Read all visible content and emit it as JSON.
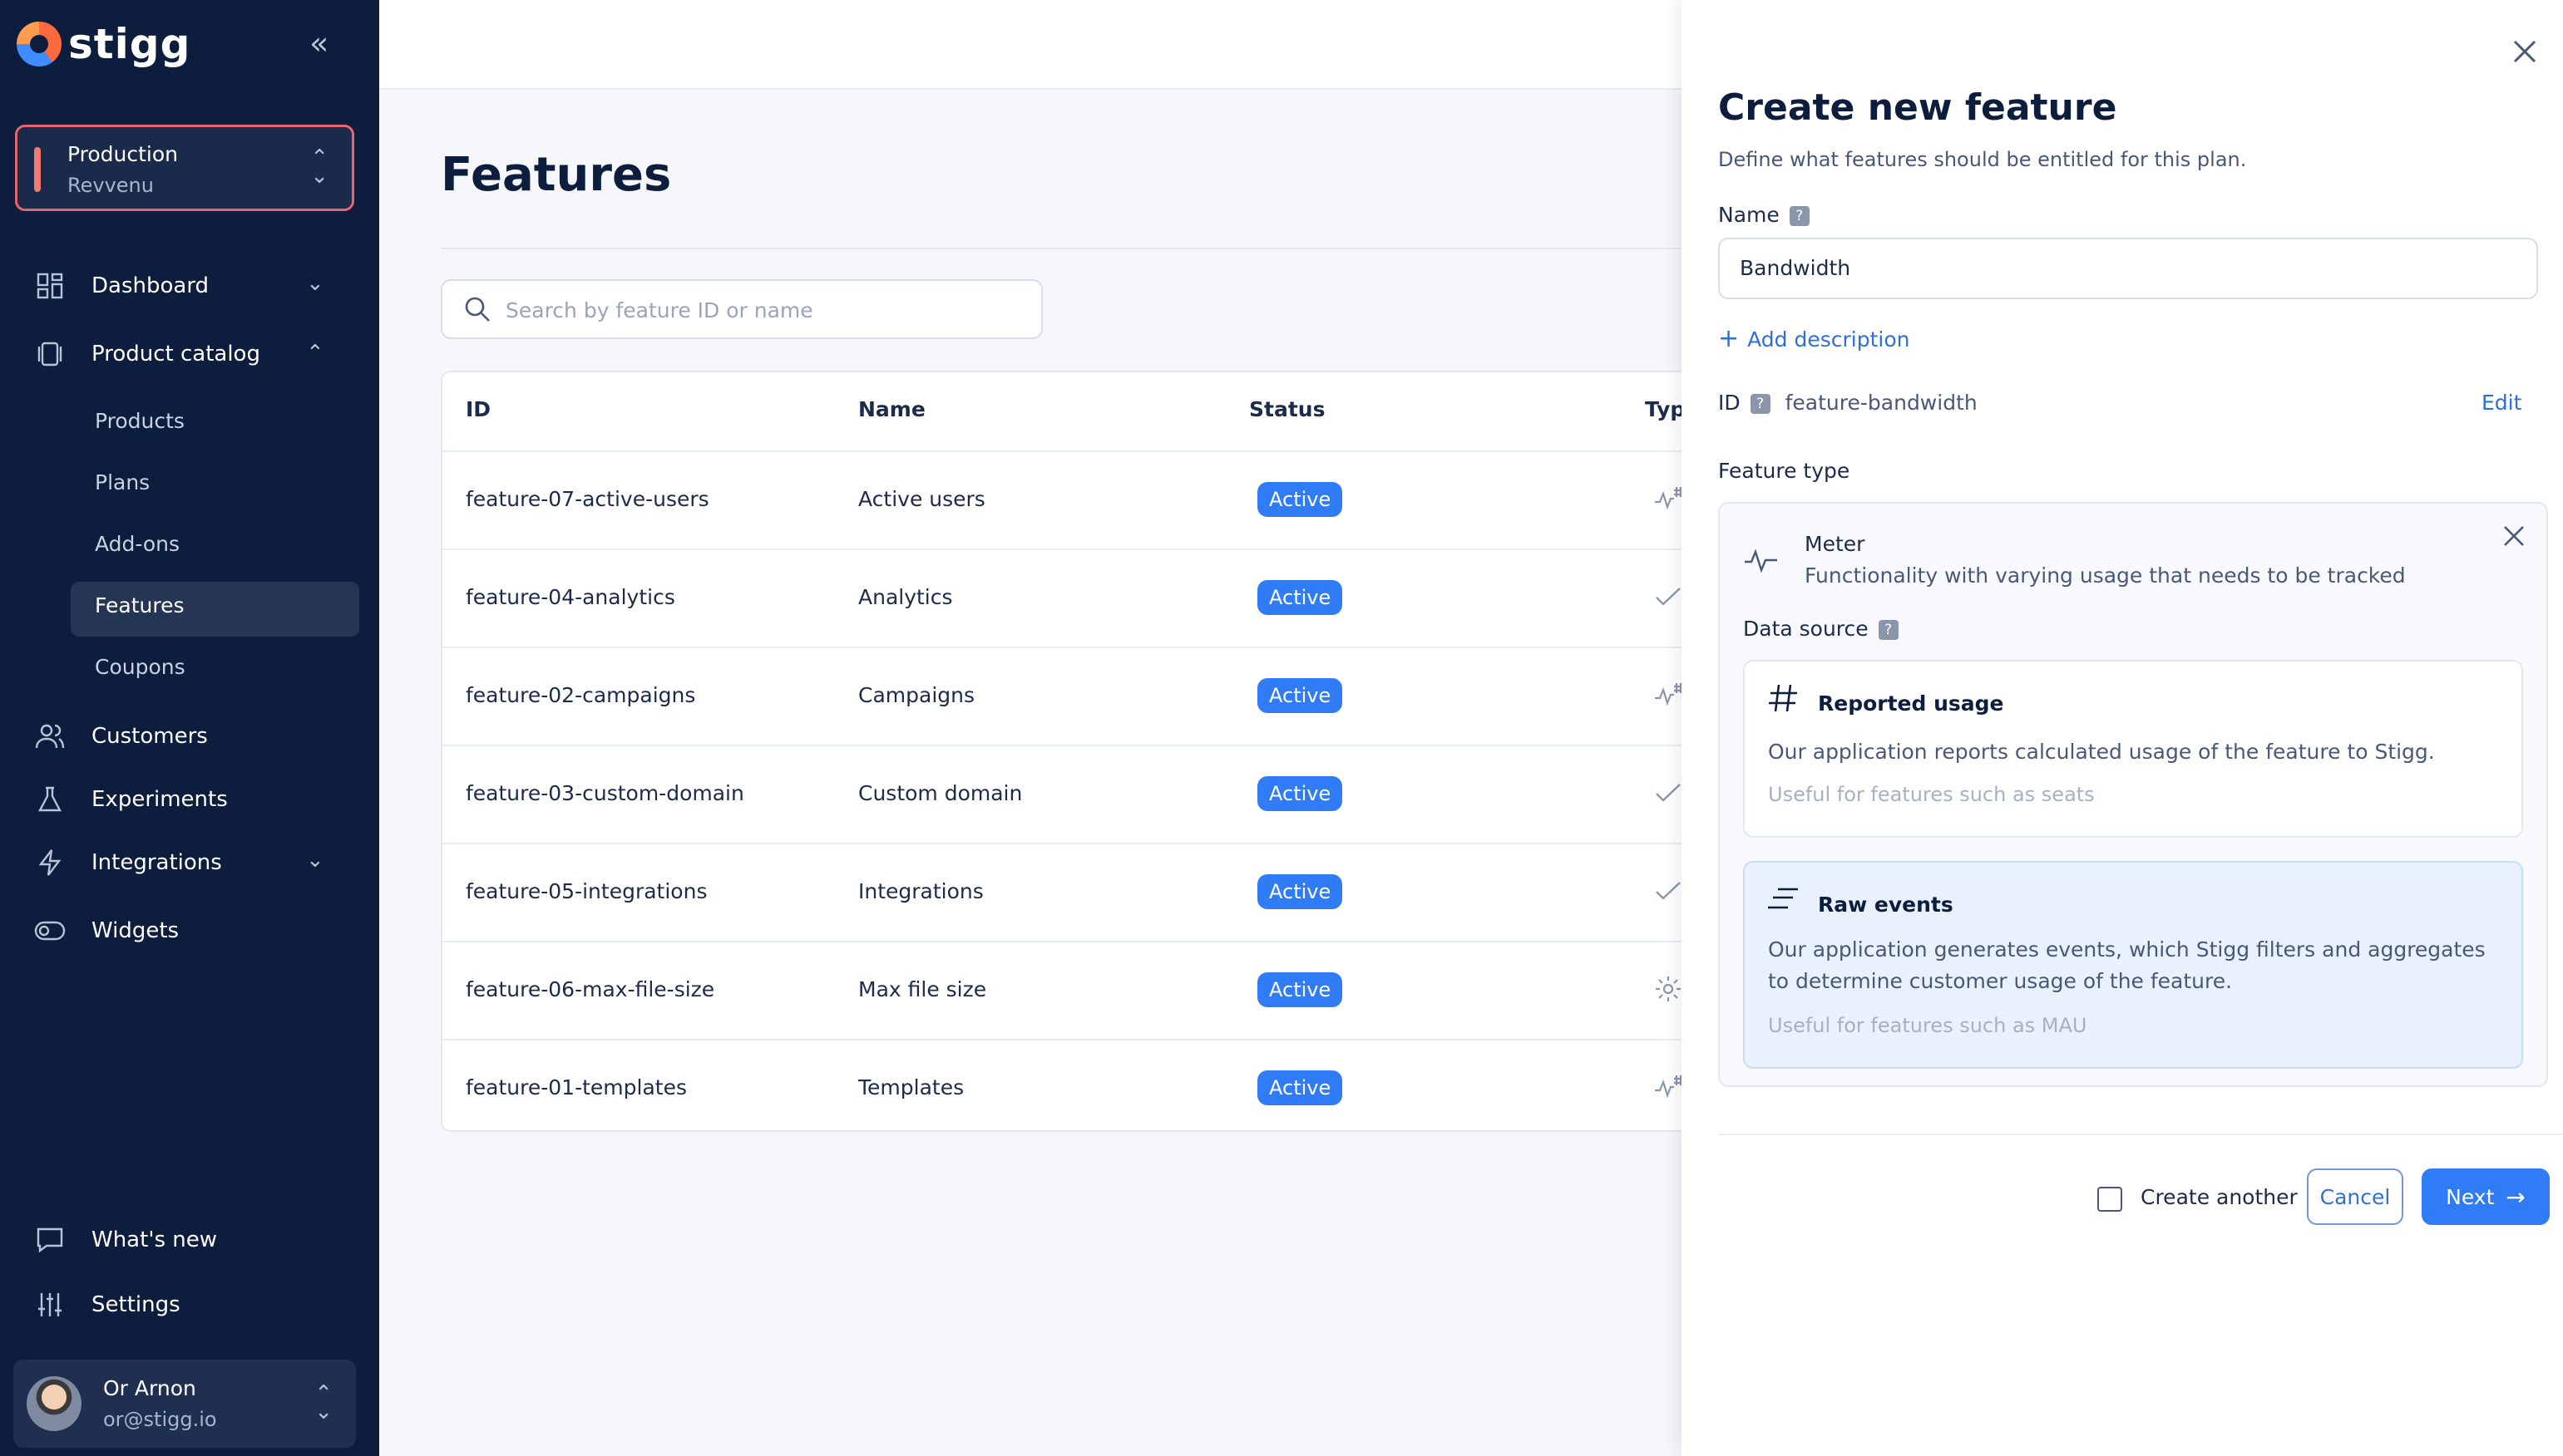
{
  "app": {
    "logo_text": "stigg"
  },
  "sidebar": {
    "environment": {
      "name": "Production",
      "account": "Revvenu"
    },
    "nav": {
      "dashboard": "Dashboard",
      "product_catalog": "Product catalog",
      "customers": "Customers",
      "experiments": "Experiments",
      "integrations": "Integrations",
      "widgets": "Widgets",
      "whats_new": "What's new",
      "settings": "Settings"
    },
    "catalog_items": [
      "Products",
      "Plans",
      "Add-ons",
      "Features",
      "Coupons"
    ],
    "active_item": "Features",
    "user": {
      "name": "Or Arnon",
      "email": "or@stigg.io"
    }
  },
  "main": {
    "title": "Features",
    "search_placeholder": "Search by feature ID or name",
    "columns": {
      "id": "ID",
      "name": "Name",
      "status": "Status",
      "type": "Typ"
    },
    "rows": [
      {
        "id": "feature-07-active-users",
        "name": "Active users",
        "status": "Active",
        "type_icon": "meter-icon"
      },
      {
        "id": "feature-04-analytics",
        "name": "Analytics",
        "status": "Active",
        "type_icon": "check-icon"
      },
      {
        "id": "feature-02-campaigns",
        "name": "Campaigns",
        "status": "Active",
        "type_icon": "meter-icon"
      },
      {
        "id": "feature-03-custom-domain",
        "name": "Custom domain",
        "status": "Active",
        "type_icon": "check-icon"
      },
      {
        "id": "feature-05-integrations",
        "name": "Integrations",
        "status": "Active",
        "type_icon": "check-icon"
      },
      {
        "id": "feature-06-max-file-size",
        "name": "Max file size",
        "status": "Active",
        "type_icon": "gear-icon"
      },
      {
        "id": "feature-01-templates",
        "name": "Templates",
        "status": "Active",
        "type_icon": "meter-icon"
      }
    ]
  },
  "drawer": {
    "title": "Create new feature",
    "subtitle": "Define what features should be entitled for this plan.",
    "name_label": "Name",
    "name_value": "Bandwidth",
    "add_description": "Add description",
    "id_label": "ID",
    "id_value": "feature-bandwidth",
    "edit_label": "Edit",
    "feature_type_label": "Feature type",
    "meter": {
      "title": "Meter",
      "description": "Functionality with varying usage that needs to be tracked"
    },
    "data_source_label": "Data source",
    "reported_usage": {
      "title": "Reported usage",
      "description": "Our application reports calculated usage of the feature to Stigg.",
      "hint": "Useful for features such as seats"
    },
    "raw_events": {
      "title": "Raw events",
      "description": "Our application generates events, which Stigg filters and aggregates to determine customer usage of the feature.",
      "hint": "Useful for features such as MAU"
    },
    "create_another_label": "Create another",
    "cancel_label": "Cancel",
    "next_label": "Next"
  },
  "colors": {
    "sidebar_bg": "#0c1d3d",
    "accent": "#2f7cf6",
    "env_border": "#e8646f",
    "selected_card_bg": "#e8f1fd"
  }
}
